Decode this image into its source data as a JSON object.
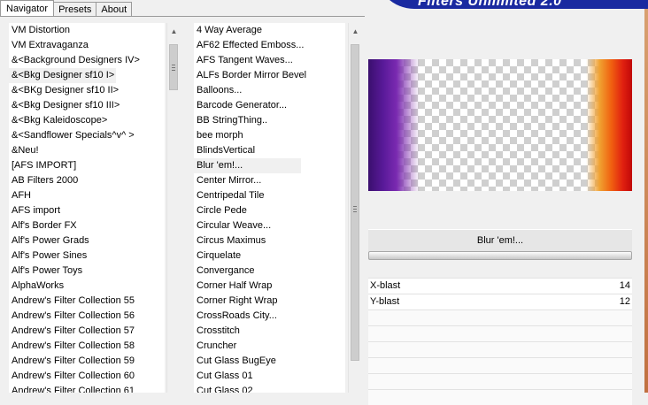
{
  "tabs": [
    "Navigator",
    "Presets",
    "About"
  ],
  "logo_text": "Filters Unlimited 2.0",
  "categories": [
    "VM Distortion",
    "VM Extravaganza",
    "&<Background Designers IV>",
    "&<Bkg Designer sf10 I>",
    "&<BKg Designer sf10 II>",
    "&<Bkg Designer sf10 III>",
    "&<Bkg Kaleidoscope>",
    "&<Sandflower Specials^v^ >",
    "&Neu!",
    "[AFS IMPORT]",
    "AB Filters 2000",
    "AFH",
    "AFS import",
    "Alf's Border FX",
    "Alf's Power Grads",
    "Alf's Power Sines",
    "Alf's Power Toys",
    "AlphaWorks",
    "Andrew's Filter Collection 55",
    "Andrew's Filter Collection 56",
    "Andrew's Filter Collection 57",
    "Andrew's Filter Collection 58",
    "Andrew's Filter Collection 59",
    "Andrew's Filter Collection 60",
    "Andrew's Filter Collection 61"
  ],
  "filters": [
    "4 Way Average",
    "AF62 Effected Emboss...",
    "AFS Tangent Waves...",
    "ALFs Border Mirror Bevel",
    "Balloons...",
    "Barcode Generator...",
    "BB StringThing..",
    "bee morph",
    "BlindsVertical",
    "Blur 'em!...",
    "Center Mirror...",
    "Centripedal Tile",
    "Circle Pede",
    "Circular Weave...",
    "Circus Maximus",
    "Cirquelate",
    "Convergance",
    "Corner Half Wrap",
    "Corner Right Wrap",
    "CrossRoads City...",
    "Crosstitch",
    "Cruncher",
    "Cut Glass  BugEye",
    "Cut Glass 01",
    "Cut Glass 02"
  ],
  "selected_filter_label": "Blur 'em!...",
  "params": [
    {
      "label": "X-blast",
      "value": "14"
    },
    {
      "label": "Y-blast",
      "value": "12"
    }
  ],
  "colors": {
    "logo_blue": "#1a2aa0",
    "gradient_left": "#5a1a9a",
    "gradient_right": "#e02010"
  }
}
